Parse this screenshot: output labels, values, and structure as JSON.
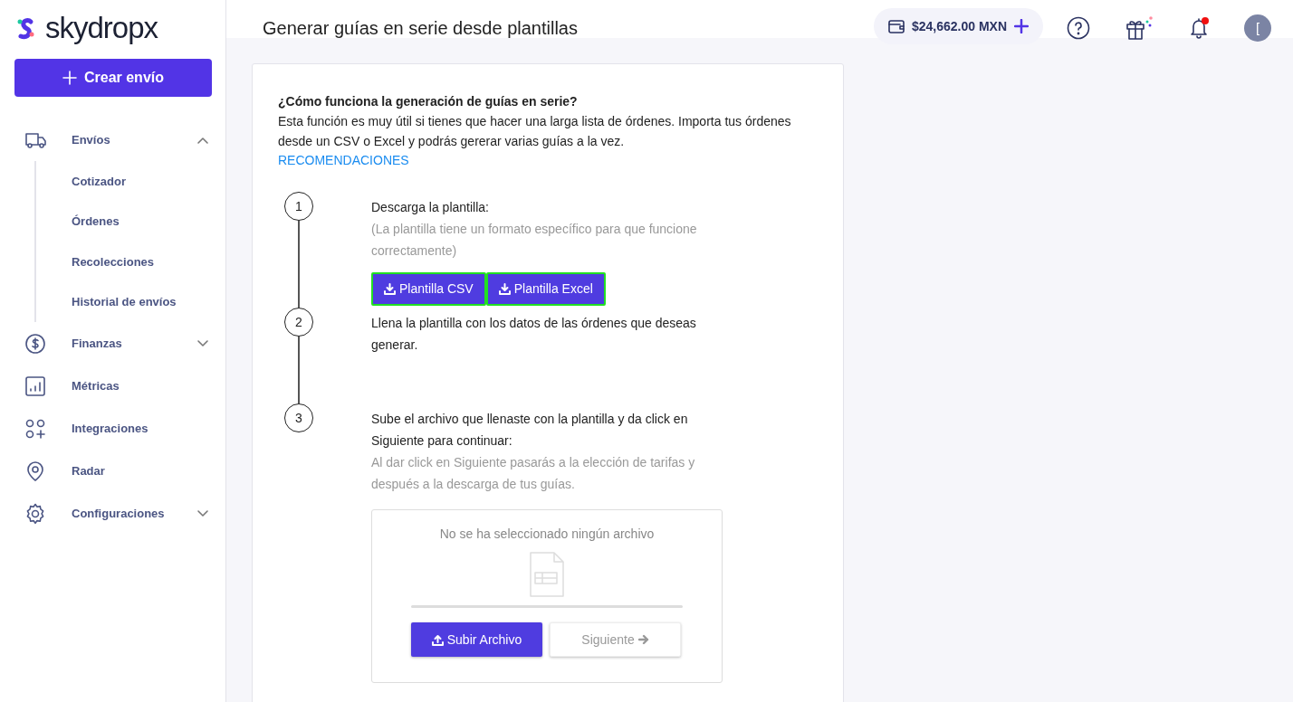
{
  "logo": {
    "text": "skydropx"
  },
  "create_button": {
    "label": "Crear envío"
  },
  "sidebar": {
    "items": [
      {
        "label": "Envíos",
        "expanded": true,
        "children": [
          {
            "label": "Cotizador"
          },
          {
            "label": "Órdenes"
          },
          {
            "label": "Recolecciones"
          },
          {
            "label": "Historial de envíos"
          }
        ]
      },
      {
        "label": "Finanzas",
        "expanded": false
      },
      {
        "label": "Métricas"
      },
      {
        "label": "Integraciones"
      },
      {
        "label": "Radar"
      },
      {
        "label": "Configuraciones",
        "expanded": false
      }
    ]
  },
  "header": {
    "title": "Generar guías en serie desde plantillas",
    "balance": "$24,662.00 MXN",
    "notification_unread": true,
    "avatar_initial": "["
  },
  "intro": {
    "heading": "¿Cómo funciona la generación de guías en serie?",
    "text": "Esta función es muy útil si tienes que hacer una larga lista de órdenes. Importa tus órdenes desde un CSV o Excel y podrás gererar varias guías a la vez.",
    "link": "RECOMENDACIONES"
  },
  "steps": [
    {
      "number": "1",
      "text": "Descarga la plantilla:",
      "hint": "(La plantilla tiene un formato específico para que funcione correctamente)",
      "buttons": [
        {
          "label": "Plantilla CSV",
          "highlighted": true
        },
        {
          "label": "Plantilla Excel",
          "highlighted": true
        }
      ]
    },
    {
      "number": "2",
      "text": "Llena la plantilla con los datos de las órdenes que deseas generar."
    },
    {
      "number": "3",
      "text": "Sube el archivo que llenaste con la plantilla y da click en Siguiente para continuar:",
      "hint": "Al dar click en Siguiente pasarás a la elección de tarifas y después a la descarga de tus guías.",
      "upload": {
        "status": "No se ha seleccionado ningún archivo",
        "level": 0,
        "upload_button": "Subir Archivo",
        "next_button": {
          "label": "Siguiente",
          "disabled": true
        }
      }
    }
  ]
}
